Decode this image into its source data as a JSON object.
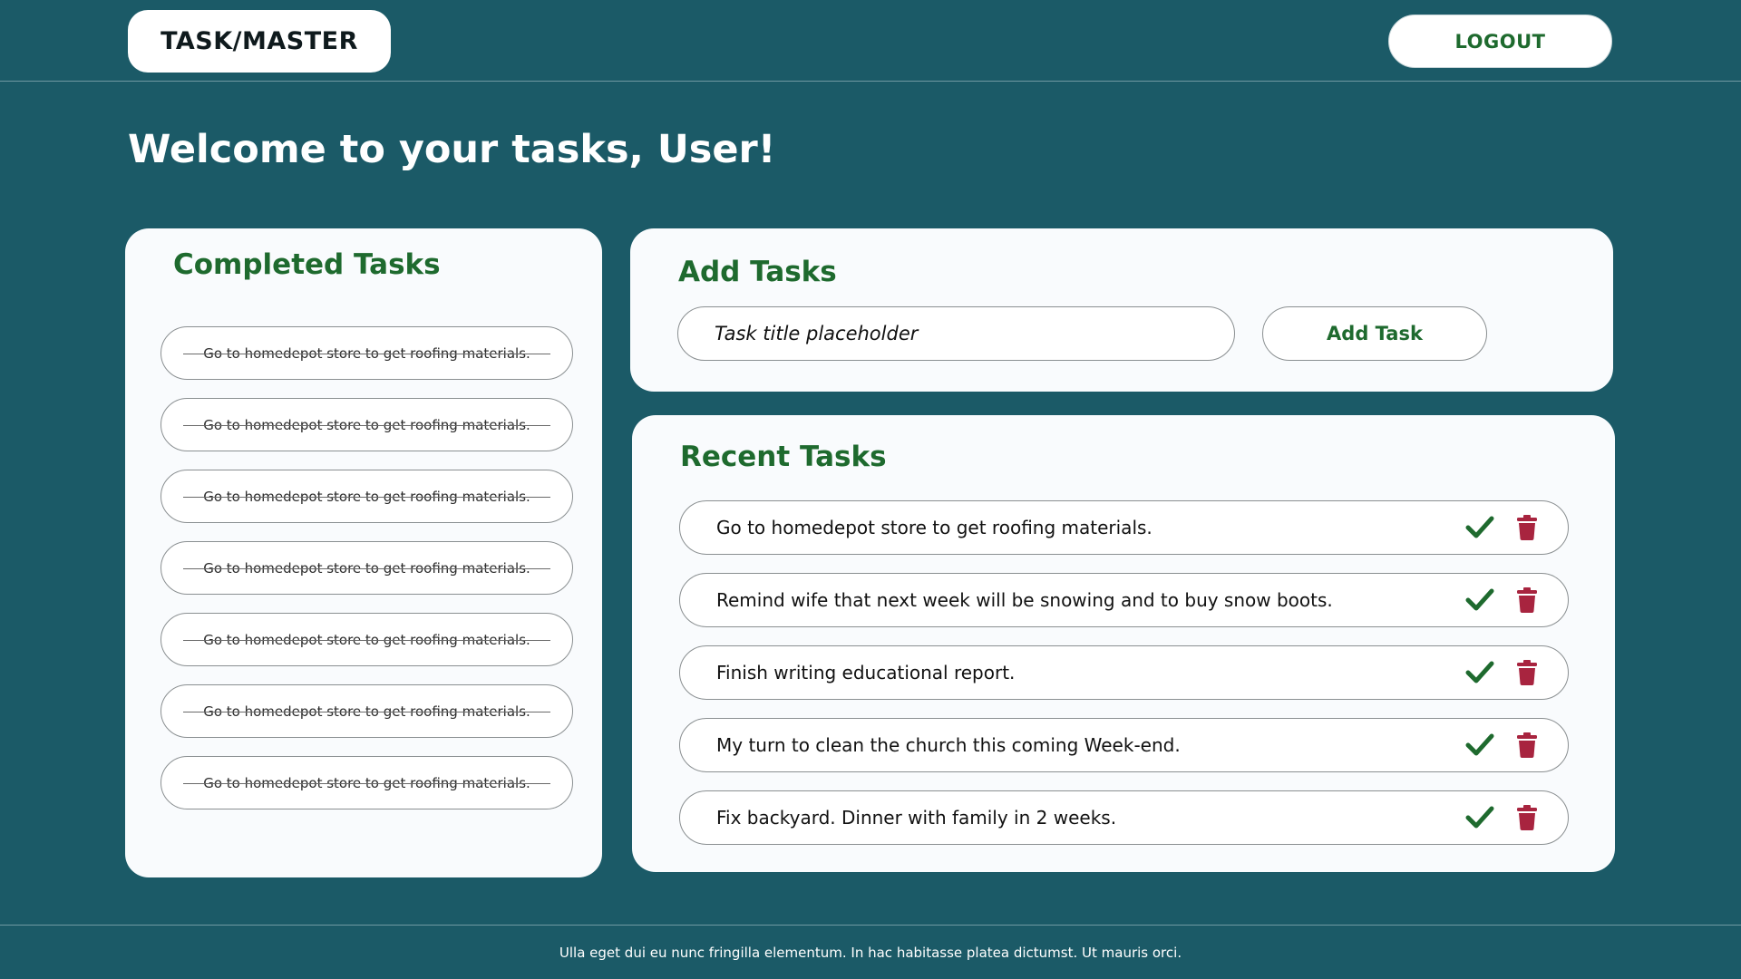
{
  "header": {
    "brand": "TASK/MASTER",
    "logout_label": "LOGOUT"
  },
  "welcome": "Welcome to your tasks, User!",
  "completed": {
    "title": "Completed Tasks",
    "items": [
      "Go to homedepot store to get roofing materials.",
      "Go to homedepot store to get roofing materials.",
      "Go to homedepot store to get roofing materials.",
      "Go to homedepot store to get roofing materials.",
      "Go to homedepot store to get roofing materials.",
      "Go to homedepot store to get roofing materials.",
      "Go to homedepot store to get roofing materials."
    ]
  },
  "add": {
    "title": "Add Tasks",
    "placeholder": "Task title placeholder",
    "value": "",
    "button_label": "Add Task"
  },
  "recent": {
    "title": "Recent Tasks",
    "items": [
      "Go to homedepot store to get roofing materials.",
      "Remind wife that next week will be snowing and to buy snow boots.",
      "Finish writing educational report.",
      "My turn to clean the church this coming Week-end.",
      "Fix backyard. Dinner with family in 2 weeks."
    ]
  },
  "icons": {
    "complete": "check-icon",
    "delete": "trash-icon"
  },
  "colors": {
    "background": "#1b5a67",
    "card": "#f9fbfd",
    "accent_green": "#1e6a2e",
    "delete_red": "#a8243f"
  },
  "footer": "Ulla eget dui eu nunc fringilla elementum. In hac habitasse platea dictumst. Ut mauris orci."
}
